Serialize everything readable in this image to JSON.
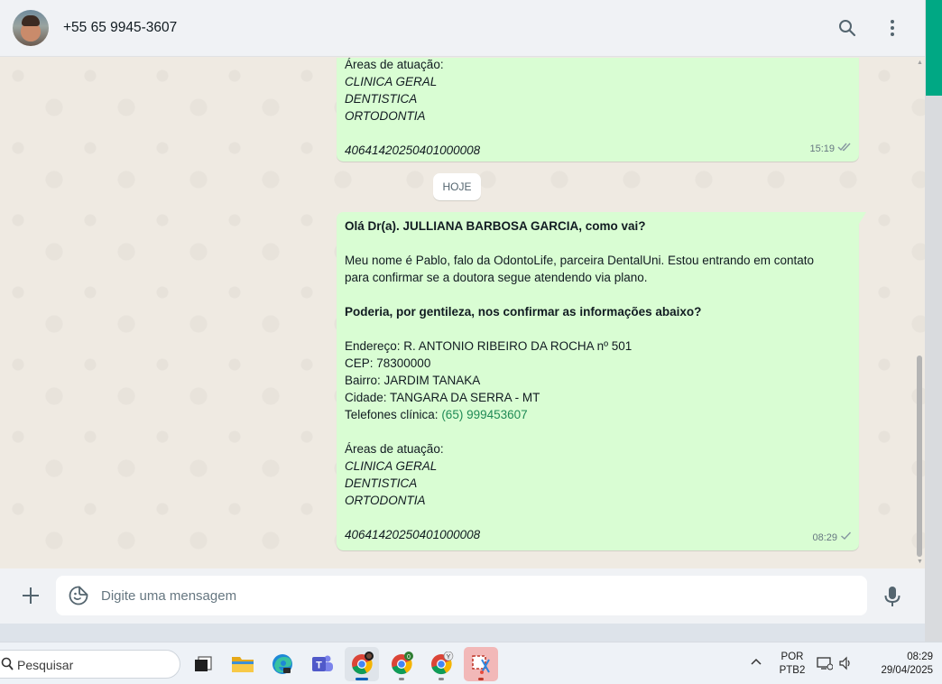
{
  "header": {
    "contact_name": "+55 65 9945-3607",
    "icons": [
      "search-icon",
      "menu-dots-icon"
    ]
  },
  "chat": {
    "prev_message": {
      "lines": [
        {
          "text": "Áreas de atuação:",
          "style": "normal"
        },
        {
          "text": "CLINICA GERAL",
          "style": "italic"
        },
        {
          "text": "DENTISTICA",
          "style": "italic"
        },
        {
          "text": "ORTODONTIA",
          "style": "italic"
        },
        {
          "text": "",
          "style": "normal"
        },
        {
          "text": "40641420250401000008",
          "style": "italic"
        }
      ],
      "time": "15:19",
      "status": "read"
    },
    "day_label": "HOJE",
    "message": {
      "greeting": "Olá Dr(a). JULLIANA BARBOSA GARCIA, como vai?",
      "intro_1": "Meu nome é Pablo, falo da OdontoLife, parceira DentalUni. Estou entrando em contato",
      "intro_2": "para confirmar se a doutora segue atendendo via plano.",
      "question": "Poderia, por gentileza, nos confirmar as informações abaixo?",
      "endereco": "Endereço: R. ANTONIO RIBEIRO DA ROCHA nº 501",
      "cep": "CEP: 78300000",
      "bairro": "Bairro: JARDIM TANAKA",
      "cidade": "Cidade: TANGARA DA SERRA - MT",
      "telefones_label": "Telefones clínica: ",
      "telefone": "(65) 999453607",
      "areas_label": "Áreas de atuação:",
      "area_1": "CLINICA GERAL",
      "area_2": "DENTISTICA",
      "area_3": "ORTODONTIA",
      "protocol": "40641420250401000008",
      "time": "08:29",
      "status": "sent"
    }
  },
  "composer": {
    "placeholder": "Digite uma mensagem",
    "icons": [
      "plus-icon",
      "sticker-icon",
      "microphone-icon"
    ]
  },
  "taskbar": {
    "search_label": "Pesquisar",
    "apps": [
      "task-view-icon",
      "file-explorer-icon",
      "edge-icon",
      "teams-icon",
      "chrome-icon",
      "chrome-icon",
      "chrome-icon",
      "snipping-tool-icon"
    ],
    "chrome_badges": [
      "",
      "0",
      "Y"
    ],
    "language": "POR",
    "keyboard": "PTB2",
    "time": "08:29",
    "date": "29/04/2025"
  },
  "colors": {
    "bubble_out": "#d9fdd3",
    "chat_bg": "#efeae2",
    "header_bg": "#f0f2f5",
    "accent": "#00a884",
    "link": "#1f8a55"
  }
}
